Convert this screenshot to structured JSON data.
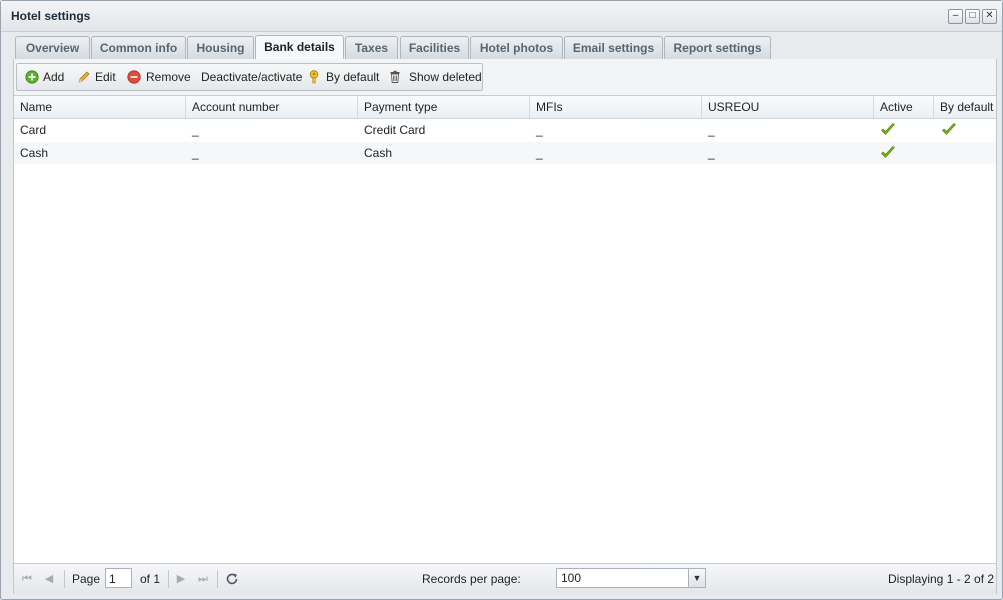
{
  "window": {
    "title": "Hotel settings"
  },
  "tabs": [
    {
      "label": "Overview"
    },
    {
      "label": "Common info"
    },
    {
      "label": "Housing"
    },
    {
      "label": "Bank details"
    },
    {
      "label": "Taxes"
    },
    {
      "label": "Facilities"
    },
    {
      "label": "Hotel photos"
    },
    {
      "label": "Email settings"
    },
    {
      "label": "Report settings"
    }
  ],
  "active_tab": "Bank details",
  "toolbar": {
    "add": "Add",
    "edit": "Edit",
    "remove": "Remove",
    "deactivate": "Deactivate/activate",
    "by_default": "By default",
    "show_deleted": "Show deleted"
  },
  "grid": {
    "columns": [
      "Name",
      "Account number",
      "Payment type",
      "MFIs",
      "USREOU",
      "Active",
      "By default"
    ],
    "rows": [
      {
        "name": "Card",
        "account": "_",
        "payment": "Credit Card",
        "mfis": "_",
        "usreou": "_",
        "active": true,
        "by_default": true
      },
      {
        "name": "Cash",
        "account": "_",
        "payment": "Cash",
        "mfis": "_",
        "usreou": "_",
        "active": true,
        "by_default": false
      }
    ]
  },
  "pager": {
    "page_label": "Page",
    "page_value": "1",
    "of_label": "of 1",
    "records_label": "Records per page:",
    "records_value": "100",
    "displaying": "Displaying 1 - 2 of 2"
  },
  "colors": {
    "check_green": "#7ab317"
  }
}
